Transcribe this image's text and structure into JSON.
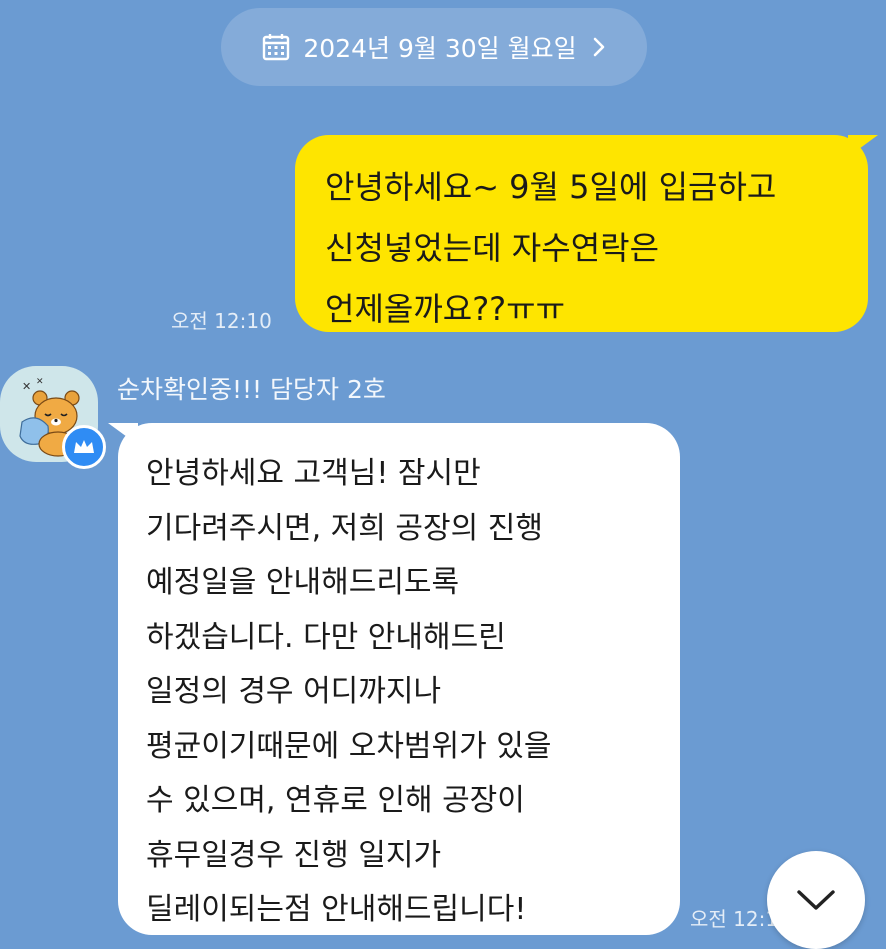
{
  "date_divider": {
    "text": "2024년 9월 30일 월요일",
    "icon": "calendar-icon",
    "chevron": "chevron-right-icon"
  },
  "messages": [
    {
      "direction": "outgoing",
      "lines": [
        "안녕하세요~ 9월 5일에 입금하고",
        "신청넣었는데 자수연락은",
        "언제올까요??ㅠㅠ"
      ],
      "time": "오전 12:10"
    },
    {
      "direction": "incoming",
      "sender": "순차확인중!!! 담당자 2호",
      "lines": [
        "안녕하세요 고객님! 잠시만",
        "기다려주시면, 저희 공장의 진행",
        "예정일을 안내해드리도록",
        "하겠습니다. 다만 안내해드린",
        "일정의 경우 어디까지나",
        "평균이기때문에 오차범위가 있을",
        "수 있으며, 연휴로 인해 공장이",
        "휴무일경우 진행 일지가",
        "딜레이되는점 안내해드립니다!"
      ],
      "time": "오전 12:1"
    }
  ],
  "colors": {
    "background": "#6b9bd2",
    "outgoing_bubble": "#fee500",
    "incoming_bubble": "#ffffff",
    "badge": "#2f8cf4"
  },
  "scroll_button": {
    "icon": "chevron-down-icon"
  }
}
